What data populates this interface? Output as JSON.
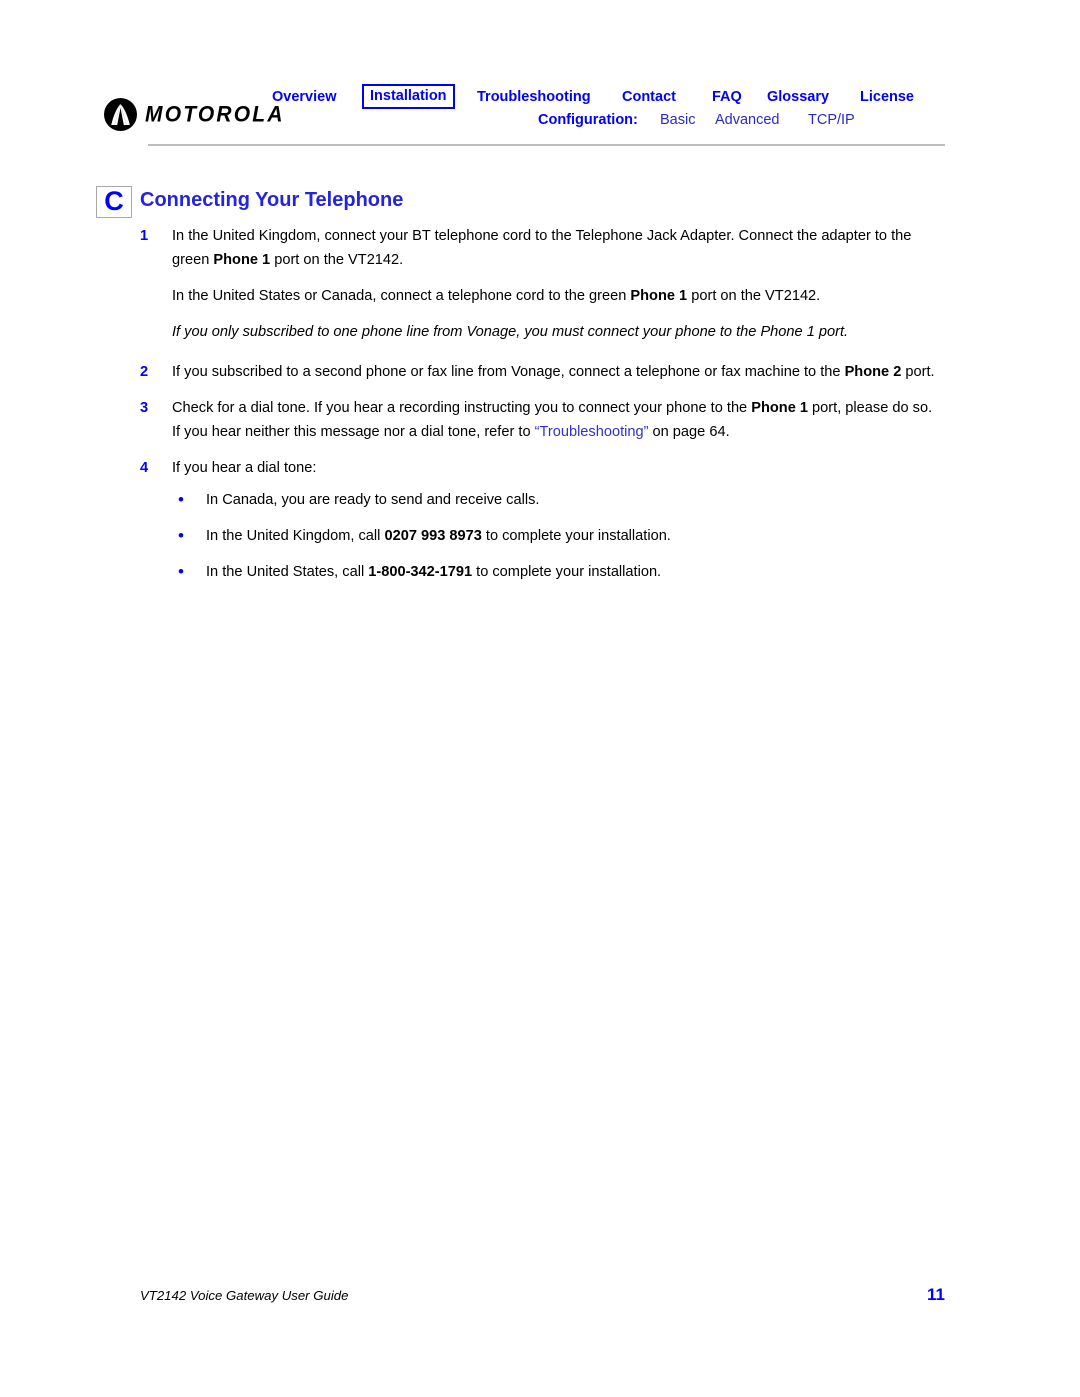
{
  "brand": {
    "name": "MOTOROLA",
    "logo_icon": "motorola-batwing-icon"
  },
  "nav": {
    "primary": [
      {
        "label": "Overview",
        "selected": false
      },
      {
        "label": "Installation",
        "selected": true
      },
      {
        "label": "Troubleshooting",
        "selected": false
      },
      {
        "label": "Contact",
        "selected": false
      },
      {
        "label": "FAQ",
        "selected": false
      },
      {
        "label": "Glossary",
        "selected": false
      },
      {
        "label": "License",
        "selected": false
      }
    ],
    "secondary_label": "Configuration:",
    "secondary": [
      {
        "label": "Basic"
      },
      {
        "label": "Advanced"
      },
      {
        "label": "TCP/IP"
      }
    ]
  },
  "section": {
    "letter": "C",
    "title": "Connecting Your Telephone"
  },
  "steps": {
    "step1": {
      "number": "1",
      "text_1": "In the United Kingdom, connect your BT telephone cord to the Telephone Jack Adapter. Connect the adapter to the green ",
      "bold_1": "Phone 1",
      "text_2": " port on the VT2142."
    },
    "para_us_canada": {
      "text_1": "In the United States or Canada, connect a telephone cord to the green ",
      "bold_1": "Phone 1",
      "text_2": " port on the VT2142."
    },
    "note": "If you only subscribed to one phone line from Vonage, you must connect your phone to the Phone 1 port.",
    "step2": {
      "number": "2",
      "text_1": "If you subscribed to a second phone or fax line from Vonage, connect a telephone or fax machine to the ",
      "bold_1": "Phone 2",
      "text_2": " port."
    },
    "step3": {
      "number": "3",
      "text_1": "Check for a dial tone. If you hear a recording instructing you to connect your phone to the ",
      "bold_1": "Phone 1",
      "text_2": " port, please do so. If you hear neither this message nor a dial tone, refer to ",
      "link_1": "“Troubleshooting”",
      "text_3": " on page 64."
    },
    "step4": {
      "number": "4",
      "text_1": "If you hear a dial tone:",
      "bullets": [
        {
          "text_1": "In Canada, you are ready to send and receive calls.",
          "bold_1": "",
          "text_2": ""
        },
        {
          "text_1": "In the United Kingdom, call ",
          "bold_1": "0207 993 8973",
          "text_2": " to complete your installation."
        },
        {
          "text_1": "In the United States, call ",
          "bold_1": "1-800-342-1791",
          "text_2": " to complete your installation."
        }
      ],
      "bullet_glyph": "•"
    }
  },
  "footer": {
    "document_title": "VT2142 Voice Gateway User Guide",
    "page_number": "11"
  },
  "colors": {
    "nav_blue": "#0000FF",
    "sub_blue": "#2A2ACC",
    "heading_blue": "#2424E0",
    "link_blue": "#3030D0",
    "rule_gray": "#BDBDBD"
  }
}
